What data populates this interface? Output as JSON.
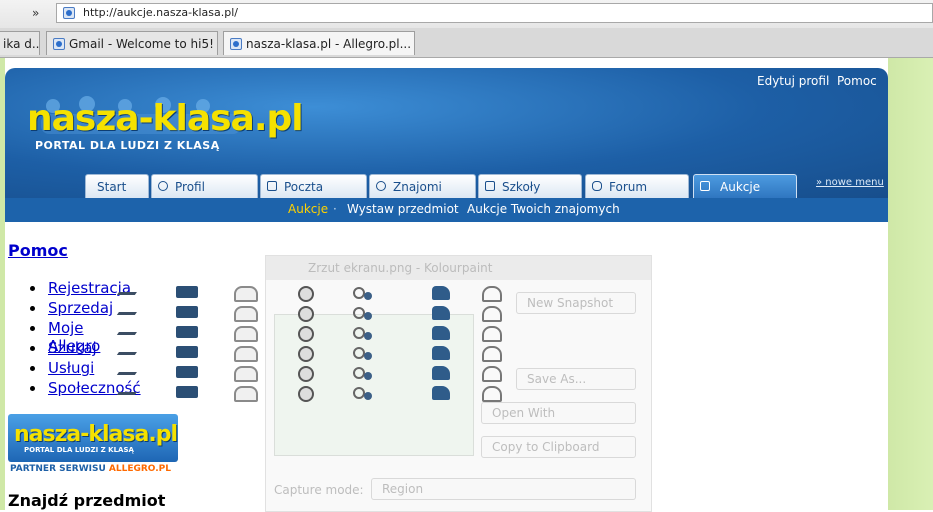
{
  "browser": {
    "chevron": "»",
    "url": "http://aukcje.nasza-klasa.pl/",
    "tabs": [
      {
        "label": "ika d..."
      },
      {
        "label": "Gmail - Welcome to hi5!"
      },
      {
        "label": "nasza-klasa.pl - Allegro.pl..."
      }
    ]
  },
  "header": {
    "links": [
      "Edytuj profil",
      "Pomoc"
    ],
    "separator": "·",
    "logo": "nasza-klasa.pl",
    "tagline": "PORTAL DLA LUDZI Z KLASĄ",
    "nowe_menu": "» nowe menu"
  },
  "nav_tabs": [
    {
      "label": "Start"
    },
    {
      "label": "Profil"
    },
    {
      "label": "Poczta"
    },
    {
      "label": "Znajomi"
    },
    {
      "label": "Szkoły"
    },
    {
      "label": "Forum"
    },
    {
      "label": "Aukcje"
    }
  ],
  "subnav": {
    "items": [
      "Aukcje",
      "Wystaw przedmiot",
      "Aukcje Twoich znajomych"
    ],
    "separator": "·"
  },
  "help": {
    "heading": "Pomoc",
    "items": [
      "Rejestracja",
      "Sprzedaj",
      "Moje Allegro",
      "Szukaj",
      "Usługi",
      "Społeczność"
    ]
  },
  "overlay": {
    "title": "Zrzut ekranu.png - Kolourpaint",
    "buttons": [
      "New Snapshot",
      "Save As...",
      "Open With",
      "Copy to Clipboard"
    ],
    "capture_label": "Capture mode:",
    "capture_value": "Region"
  },
  "partner": {
    "logo": "nasza-klasa.pl",
    "tagline": "PORTAL DLA LUDZI Z KLASĄ",
    "prefix": "PARTNER SERWISU ",
    "brand": "ALLEGRO.PL"
  },
  "find_heading": "Znajdź przedmiot",
  "colors": {
    "header_blue": "#1d5fa6",
    "logo_yellow": "#f5e100",
    "active_subnav": "#ffd200",
    "page_green": "#cfe8a7",
    "link_blue": "#0000cc"
  }
}
